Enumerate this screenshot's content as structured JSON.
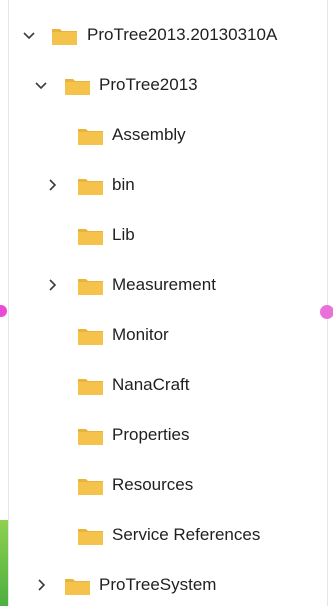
{
  "tree": {
    "items": [
      {
        "label": "ProTree2013.20130310A",
        "level": 0,
        "state": "expanded"
      },
      {
        "label": "ProTree2013",
        "level": 1,
        "state": "expanded"
      },
      {
        "label": "Assembly",
        "level": 2,
        "state": "leaf"
      },
      {
        "label": "bin",
        "level": 2,
        "state": "collapsed"
      },
      {
        "label": "Lib",
        "level": 2,
        "state": "leaf"
      },
      {
        "label": "Measurement",
        "level": 2,
        "state": "collapsed"
      },
      {
        "label": "Monitor",
        "level": 2,
        "state": "leaf"
      },
      {
        "label": "NanaCraft",
        "level": 2,
        "state": "leaf"
      },
      {
        "label": "Properties",
        "level": 2,
        "state": "leaf"
      },
      {
        "label": "Resources",
        "level": 2,
        "state": "leaf"
      },
      {
        "label": "Service References",
        "level": 2,
        "state": "leaf"
      },
      {
        "label": "ProTreeSystem",
        "level": 1,
        "state": "collapsed"
      }
    ]
  },
  "icons": {
    "expanded_chevron": "chevron-down-icon",
    "collapsed_chevron": "chevron-right-icon",
    "folder": "folder-icon"
  },
  "colors": {
    "folder_main": "#f5c24c",
    "folder_tab": "#e9b43b",
    "chevron": "#3c3c3c",
    "text": "#1f1f1f"
  }
}
